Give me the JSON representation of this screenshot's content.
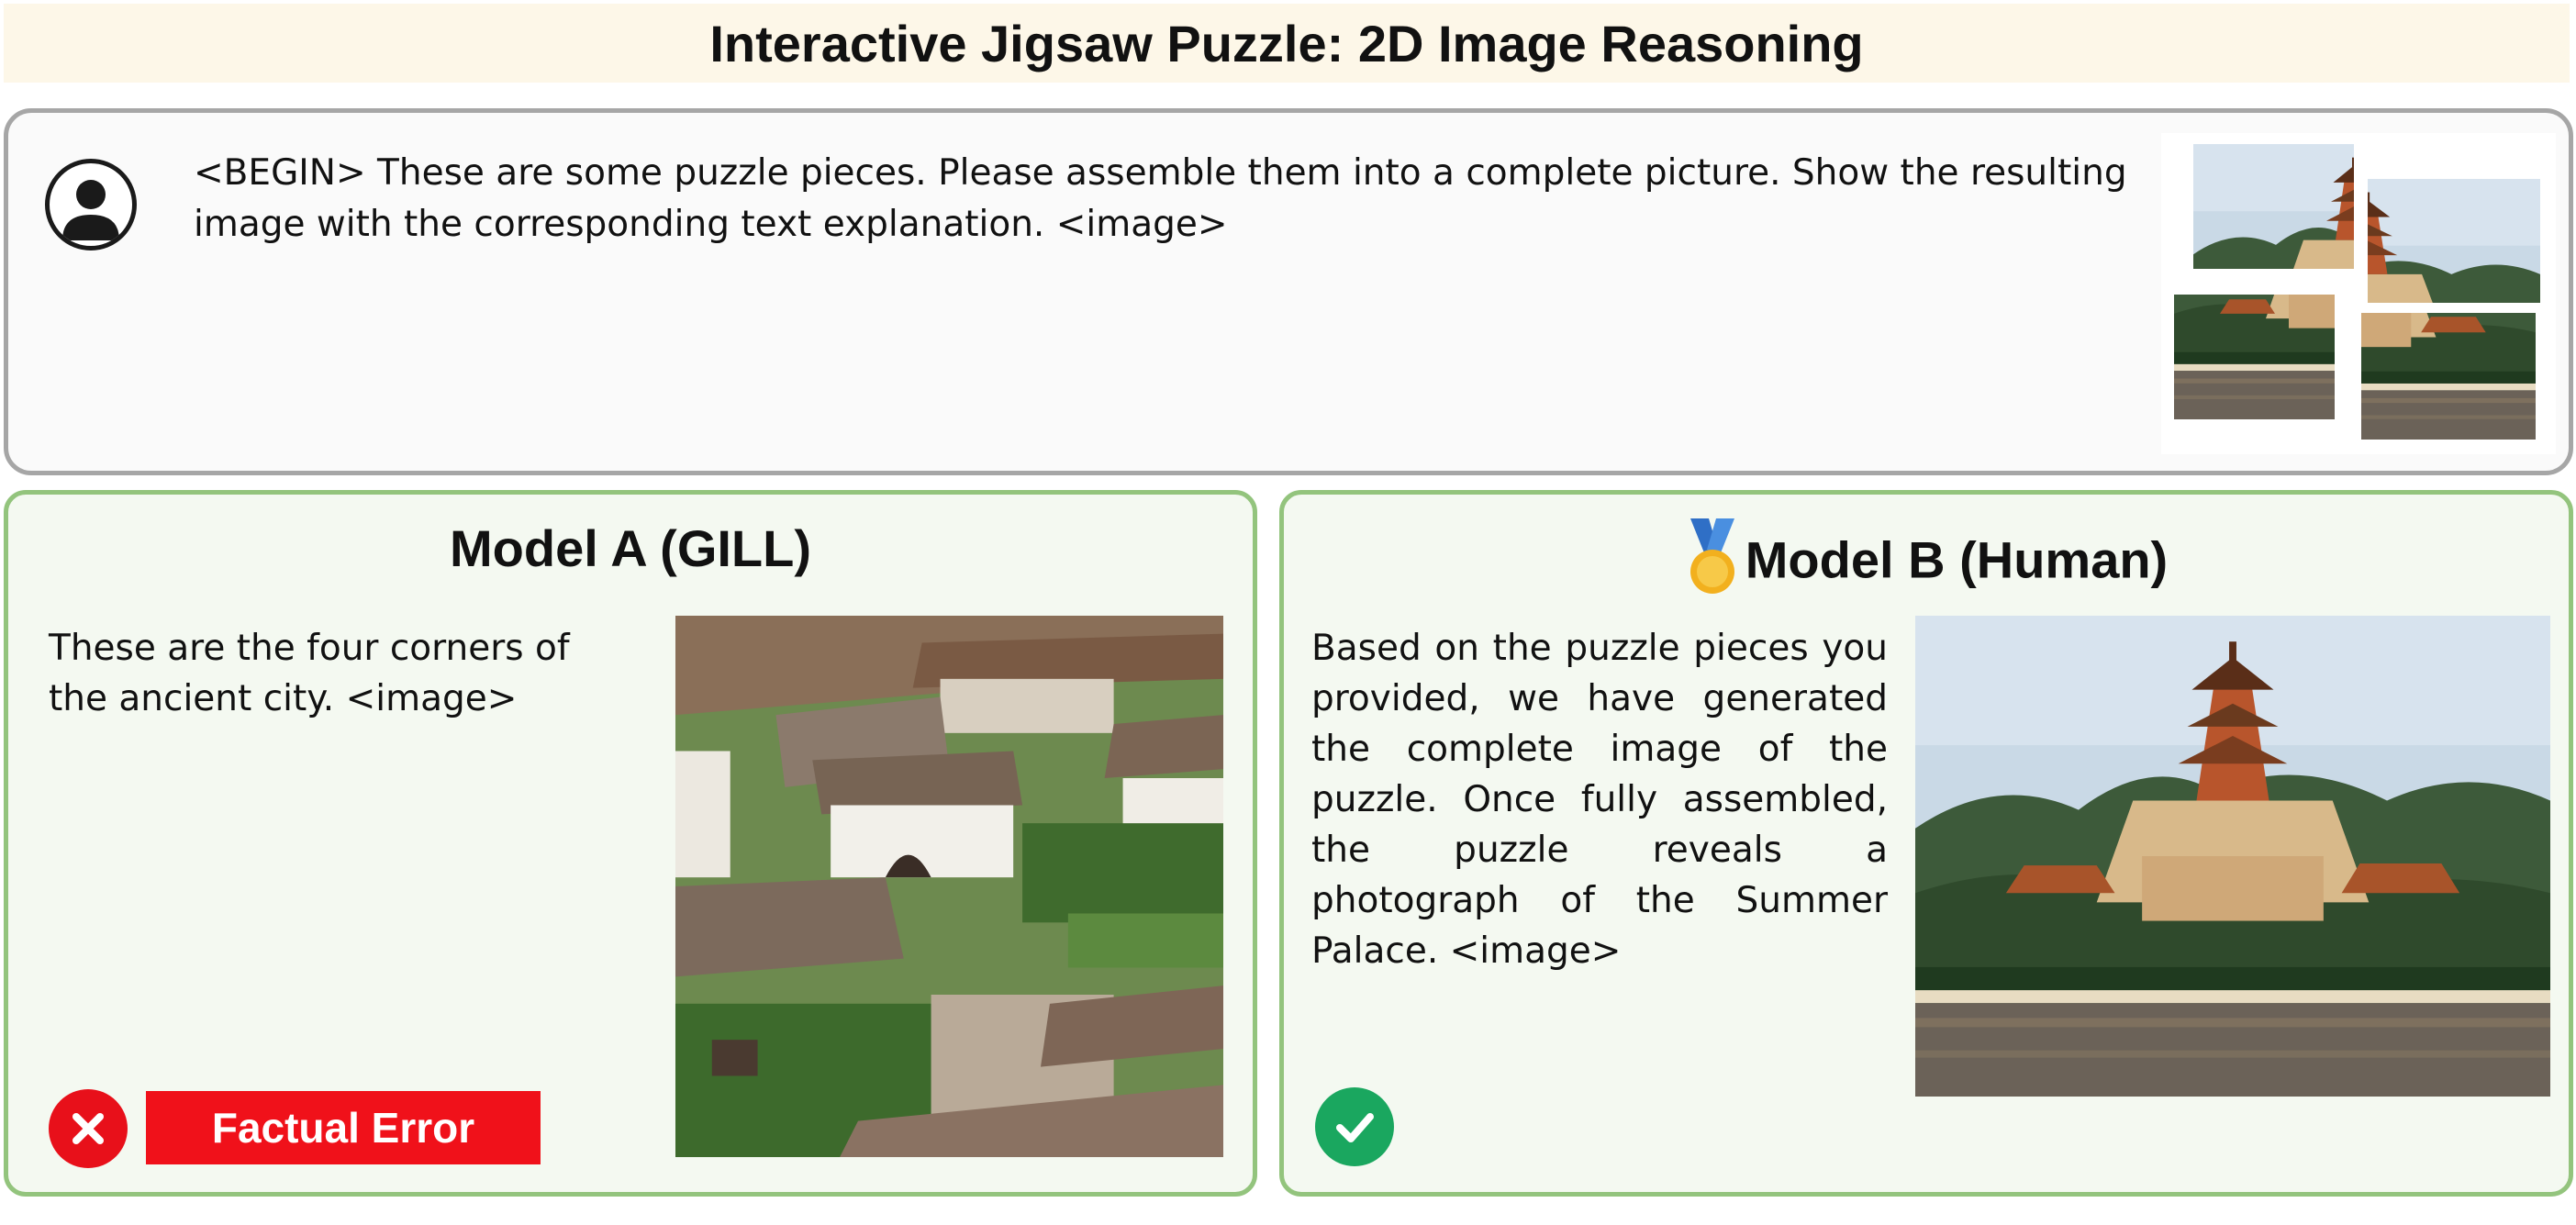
{
  "title": "Interactive Jigsaw Puzzle: 2D Image Reasoning",
  "prompt": {
    "avatar_icon": "user-avatar-icon",
    "text": "<BEGIN> These are some puzzle pieces. Please assemble them into a complete picture. Show the resulting image with the corresponding text explanation. <image>",
    "pieces_count": 4
  },
  "model_a": {
    "title": "Model A (GILL)",
    "response": "These are the four corners of the ancient city. <image>",
    "status_icon": "x-icon",
    "status_color": "#e8101a",
    "badge_label": "Factual Error"
  },
  "model_b": {
    "title": "Model B (Human)",
    "medal_icon": "medal-icon",
    "response": "Based on the puzzle pieces you provided, we have generated the complete image of the puzzle. Once fully assembled, the puzzle reveals a photograph of the Summer Palace. <image>",
    "status_icon": "check-icon",
    "status_color": "#1aa75f"
  },
  "colors": {
    "title_bg": "#fdf7e8",
    "prompt_border": "#a6a6a6",
    "panel_border": "#93c47d",
    "panel_bg": "#f4f9f1"
  }
}
